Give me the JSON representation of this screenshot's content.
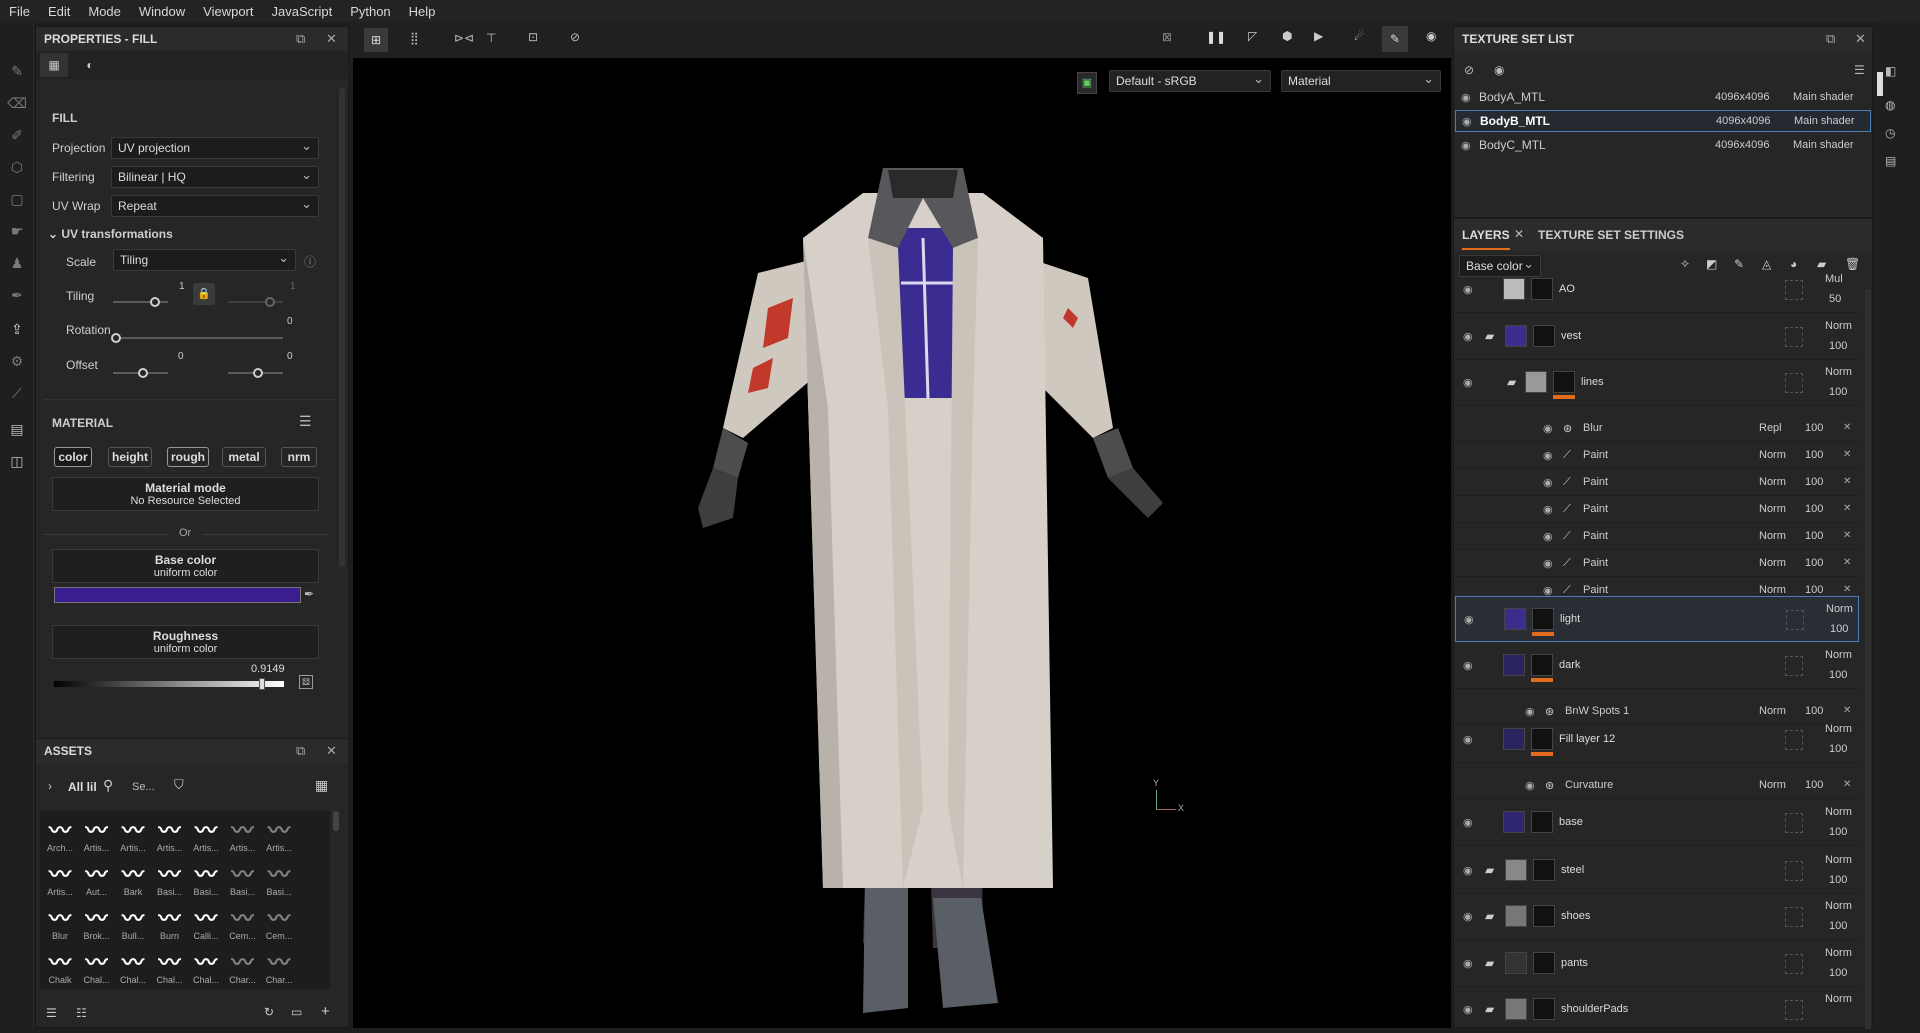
{
  "menu": [
    "File",
    "Edit",
    "Mode",
    "Window",
    "Viewport",
    "JavaScript",
    "Python",
    "Help"
  ],
  "properties": {
    "title": "PROPERTIES - FILL",
    "section": "FILL",
    "projection_label": "Projection",
    "projection": "UV projection",
    "filtering_label": "Filtering",
    "filtering": "Bilinear | HQ",
    "uvwrap_label": "UV Wrap",
    "uvwrap": "Repeat",
    "uvt": "UV transformations",
    "scale_label": "Scale",
    "scale": "Tiling",
    "tiling_label": "Tiling",
    "tiling_a": "1",
    "tiling_b": "1",
    "rotation_label": "Rotation",
    "rotation": "0",
    "offset_label": "Offset",
    "offset_a": "0",
    "offset_b": "0",
    "material": "MATERIAL",
    "channels": [
      "color",
      "height",
      "rough",
      "metal",
      "nrm"
    ],
    "material_mode": "Material mode",
    "no_resource": "No Resource Selected",
    "or": "Or",
    "base_color": "Base color",
    "uniform": "uniform color",
    "base_color_value": "#3a1d8f",
    "roughness": "Roughness",
    "roughness_value": "0.9149",
    "roughness_fraction": 0.9149
  },
  "assets": {
    "title": "ASSETS",
    "filter": "All lil",
    "search": "Se...",
    "items": [
      [
        "Arch...",
        "Artis...",
        "Artis...",
        "Artis...",
        "Artis...",
        "Artis...",
        "Artis..."
      ],
      [
        "Artis...",
        "Aut...",
        "Bark",
        "Basi...",
        "Basi...",
        "Basi...",
        "Basi..."
      ],
      [
        "Blur",
        "Brok...",
        "Bull...",
        "Burn",
        "Calli...",
        "Cem...",
        "Cem..."
      ],
      [
        "Chalk",
        "Chal...",
        "Chal...",
        "Chal...",
        "Chal...",
        "Char...",
        "Char..."
      ]
    ]
  },
  "viewport": {
    "colorspace": "Default - sRGB",
    "mode": "Material",
    "axis_y": "Y",
    "axis_x": "X"
  },
  "texture_set_list": {
    "title": "TEXTURE SET LIST",
    "sets": [
      {
        "name": "BodyA_MTL",
        "res": "4096x4096",
        "shader": "Main shader"
      },
      {
        "name": "BodyB_MTL",
        "res": "4096x4096",
        "shader": "Main shader"
      },
      {
        "name": "BodyC_MTL",
        "res": "4096x4096",
        "shader": "Main shader"
      }
    ]
  },
  "layers": {
    "tab1": "LAYERS",
    "tab2": "TEXTURE SET SETTINGS",
    "channel": "Base color",
    "items": [
      {
        "name": "AO",
        "blend": "Mul",
        "op": "50"
      },
      {
        "name": "vest",
        "blend": "Norm",
        "op": "100"
      },
      {
        "name": "lines",
        "blend": "Norm",
        "op": "100"
      },
      {
        "name": "Blur",
        "blend": "Repl",
        "op": "100"
      },
      {
        "name": "Paint",
        "blend": "Norm",
        "op": "100"
      },
      {
        "name": "Paint",
        "blend": "Norm",
        "op": "100"
      },
      {
        "name": "Paint",
        "blend": "Norm",
        "op": "100"
      },
      {
        "name": "Paint",
        "blend": "Norm",
        "op": "100"
      },
      {
        "name": "Paint",
        "blend": "Norm",
        "op": "100"
      },
      {
        "name": "Paint",
        "blend": "Norm",
        "op": "100"
      },
      {
        "name": "light",
        "blend": "Norm",
        "op": "100"
      },
      {
        "name": "dark",
        "blend": "Norm",
        "op": "100"
      },
      {
        "name": "BnW Spots 1",
        "blend": "Norm",
        "op": "100"
      },
      {
        "name": "Fill layer 12",
        "blend": "Norm",
        "op": "100"
      },
      {
        "name": "Curvature",
        "blend": "Norm",
        "op": "100"
      },
      {
        "name": "base",
        "blend": "Norm",
        "op": "100"
      },
      {
        "name": "steel",
        "blend": "Norm",
        "op": "100"
      },
      {
        "name": "shoes",
        "blend": "Norm",
        "op": "100"
      },
      {
        "name": "pants",
        "blend": "Norm",
        "op": "100"
      },
      {
        "name": "shoulderPads",
        "blend": "Norm",
        "op": ""
      }
    ]
  }
}
